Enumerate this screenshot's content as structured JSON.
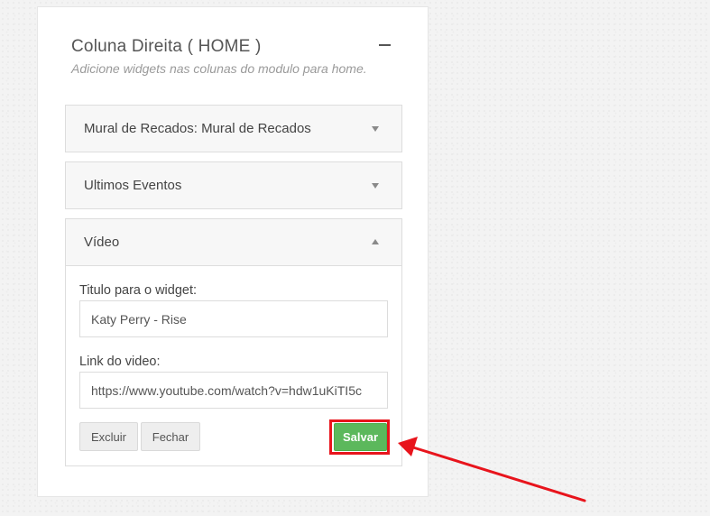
{
  "panel": {
    "title": "Coluna Direita ( HOME )",
    "subtitle": "Adicione widgets nas colunas do modulo para home.",
    "collapse_icon": "minus-icon"
  },
  "widgets": [
    {
      "title": "Mural de Recados: Mural de Recados",
      "state": "collapsed",
      "icon": "caret-down-icon"
    },
    {
      "title": "Ultimos Eventos",
      "state": "collapsed",
      "icon": "caret-down-icon"
    },
    {
      "title": "Vídeo",
      "state": "expanded",
      "icon": "caret-up-icon"
    }
  ],
  "video_form": {
    "title_label": "Titulo para o widget:",
    "title_value": "Katy Perry - Rise",
    "link_label": "Link do video:",
    "link_value": "https://www.youtube.com/watch?v=hdw1uKiTI5c",
    "delete_label": "Excluir",
    "close_label": "Fechar",
    "save_label": "Salvar"
  },
  "colors": {
    "save_button": "#5cb85c",
    "annotation": "#e8141c",
    "header_background": "#f7f7f7"
  }
}
